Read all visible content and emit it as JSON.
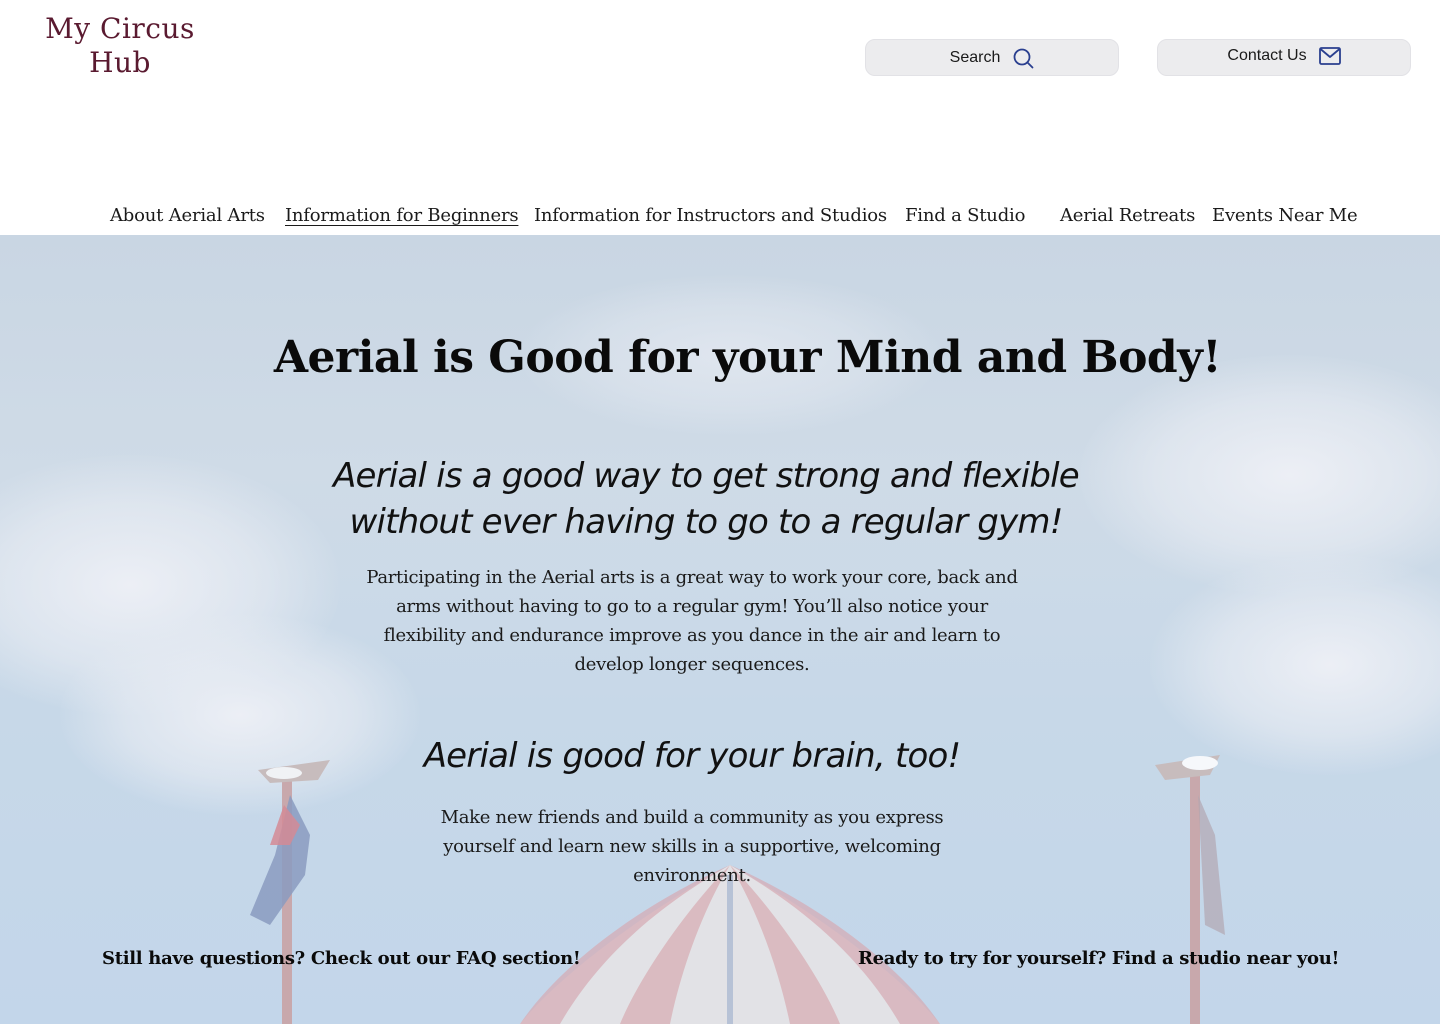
{
  "header": {
    "logo_line1": "My Circus",
    "logo_line2": "Hub",
    "logo_color": "#5a1a30",
    "search_label": "Search",
    "search_icon": "search-icon",
    "contact_label": "Contact Us",
    "contact_icon": "mail-icon"
  },
  "nav": {
    "items": [
      {
        "label": "About Aerial Arts"
      },
      {
        "label": "Information for Beginners",
        "active": true
      },
      {
        "label": "Information for Instructors and Studios"
      },
      {
        "label": "Find a Studio"
      },
      {
        "label": "Aerial Retreats"
      },
      {
        "label": "Events Near Me"
      }
    ]
  },
  "hero": {
    "title": "Aerial is Good for your Mind and Body!",
    "subtitle1": "Aerial is a good way to get strong and flexible without ever having to go to a regular gym!",
    "paragraph1": "Participating in the Aerial arts is a great way to work your core, back and arms without having to go to a regular gym! You’ll also notice your flexibility and endurance improve as you dance in the air and learn to develop longer sequences.",
    "subtitle2": "Aerial is good for your brain, too!",
    "paragraph2": "Make new friends and build a community as you express yourself and learn new skills in a supportive, welcoming environment.",
    "cta_left": "Still have questions? Check out our FAQ section!",
    "cta_right": "Ready to try for yourself? Find a studio near you!",
    "background_image": "circus tent under a cloudy sky"
  },
  "colors": {
    "accent_icon": "#2a3f8f",
    "pill_bg": "#ececee"
  }
}
